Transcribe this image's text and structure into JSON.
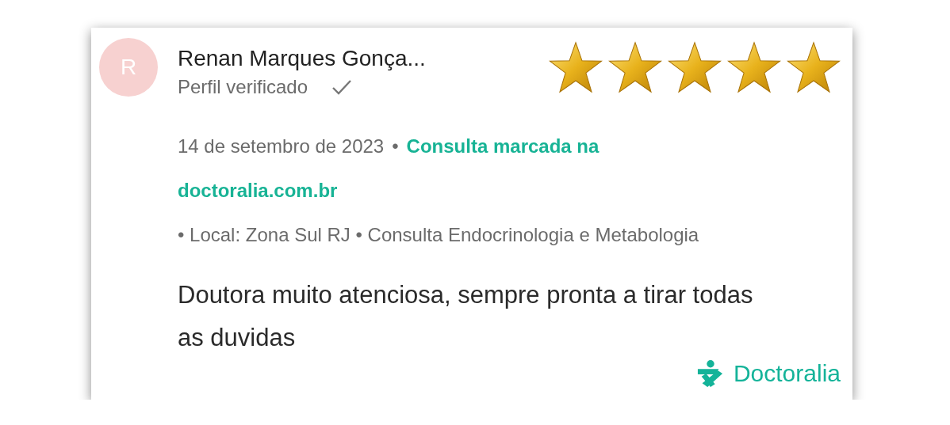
{
  "review": {
    "avatar_initial": "R",
    "reviewer_name": "Renan Marques Gonça...",
    "verified_label": "Perfil verificado",
    "verified": true,
    "stars": 5,
    "date": "14 de setembro de 2023",
    "separator": "•",
    "booking_text": "Consulta marcada na",
    "booking_site": "doctoralia.com.br",
    "details": "• Local: Zona Sul RJ • Consulta Endocrinologia e Metabologia",
    "comment": "Doutora muito atenciosa, sempre pronta a tirar todas as duvidas"
  },
  "brand": {
    "name": "Doctoralia"
  }
}
